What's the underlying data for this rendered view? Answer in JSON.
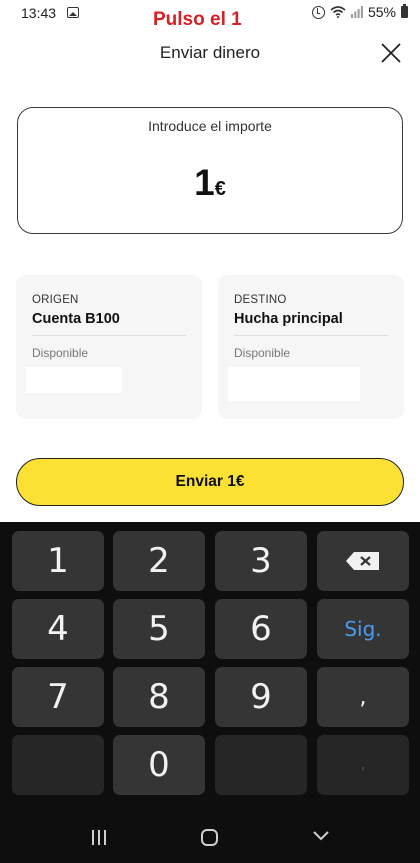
{
  "status_bar": {
    "time": "13:43",
    "battery": "55%",
    "icons": [
      "gallery-icon",
      "alarm-icon",
      "wifi-icon",
      "signal-icon",
      "battery-icon"
    ]
  },
  "annotation": "Pulso el 1",
  "header": {
    "title": "Enviar dinero",
    "close_icon": "close-icon"
  },
  "amount": {
    "label": "Introduce el importe",
    "value": "1",
    "currency": "€"
  },
  "origin": {
    "label": "ORIGEN",
    "account": "Cuenta B100",
    "available_label": "Disponible"
  },
  "destination": {
    "label": "DESTINO",
    "account": "Hucha principal",
    "available_label": "Disponible"
  },
  "send_button": {
    "label": "Enviar 1€"
  },
  "keyboard": {
    "keys": {
      "k1": "1",
      "k2": "2",
      "k3": "3",
      "k4": "4",
      "k5": "5",
      "k6": "6",
      "k7": "7",
      "k8": "8",
      "k9": "9",
      "k0": "0",
      "next": "Sig.",
      "comma": ",",
      "comma_alt": ","
    },
    "backspace_icon": "backspace-icon"
  },
  "nav_bar": {
    "icons": [
      "recent-apps-icon",
      "home-icon",
      "back-icon"
    ]
  },
  "colors": {
    "accent_yellow": "#fbe133",
    "annotation_red": "#d81f26",
    "keyboard_bg": "#0e0e0e",
    "key_bg": "#353535",
    "next_key_blue": "#4a9bf0"
  }
}
